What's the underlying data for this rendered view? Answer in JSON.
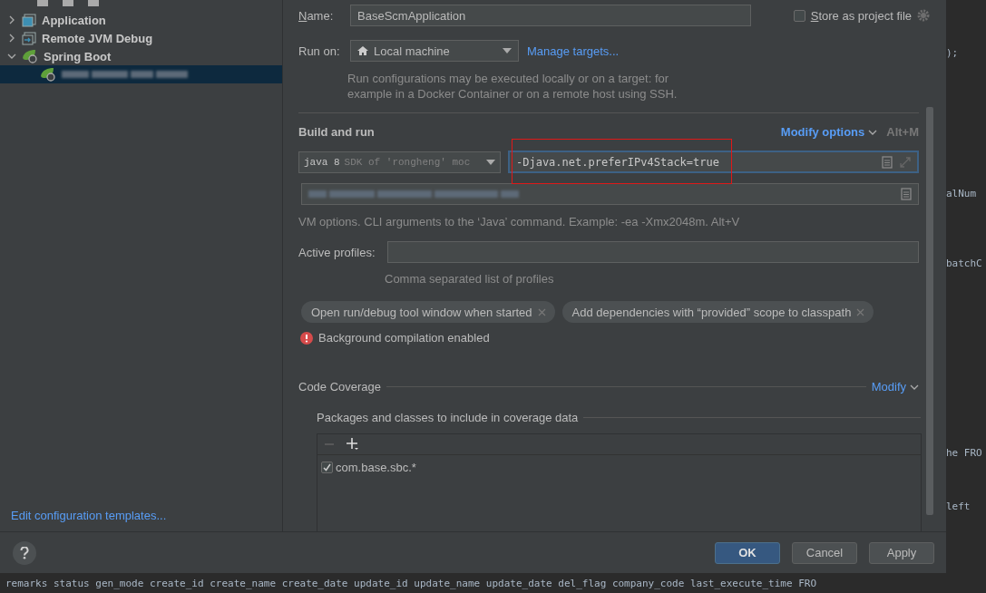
{
  "tree": [
    {
      "kind": "application",
      "label": "Application",
      "expanded": false,
      "selected": false
    },
    {
      "kind": "remote",
      "label": "Remote JVM Debug",
      "expanded": false,
      "selected": false
    },
    {
      "kind": "spring",
      "label": "Spring Boot",
      "expanded": true,
      "selected": false,
      "children": [
        {
          "kind": "spring",
          "selected": true
        }
      ]
    }
  ],
  "templates_link": "Edit configuration templates...",
  "name": {
    "label": "Name:",
    "value": "BaseScmApplication"
  },
  "store_as_project_file": {
    "label": "Store as project file",
    "checked": false
  },
  "run_on": {
    "label": "Run on:",
    "value": "Local machine",
    "link": "Manage targets...",
    "description": "Run configurations may be executed locally or on a target: for example in a Docker Container or on a remote host using SSH."
  },
  "build_and_run": {
    "title": "Build and run",
    "modify": "Modify options",
    "shortcut": "Alt+M",
    "sdk_main": "java 8",
    "sdk_detail": "SDK of 'rongheng' moc",
    "vm_options": "-Djava.net.preferIPv4Stack=true",
    "vm_hint": "VM options. CLI arguments to the ‘Java’ command. Example: -ea -Xmx2048m. Alt+V"
  },
  "active_profiles": {
    "label": "Active profiles:",
    "hint": "Comma separated list of profiles"
  },
  "chips": [
    "Open run/debug tool window when started",
    "Add dependencies with “provided” scope to classpath"
  ],
  "warning": "Background compilation enabled",
  "code_coverage": {
    "title": "Code Coverage",
    "modify": "Modify",
    "packages_title": "Packages and classes to include in coverage data",
    "packages": [
      {
        "label": "com.base.sbc.*",
        "checked": true
      }
    ]
  },
  "buttons": [
    {
      "label": "OK",
      "primary": true
    },
    {
      "label": "Cancel",
      "primary": false
    },
    {
      "label": "Apply",
      "primary": false
    }
  ],
  "editor_fragments": [
    ");",
    "alNum",
    "batchC",
    "he FRO",
    "left"
  ],
  "editor_bottom_line": "remarks status gen_mode create_id create_name create_date update_id update_name update_date del_flag company_code last_execute_time FRO"
}
